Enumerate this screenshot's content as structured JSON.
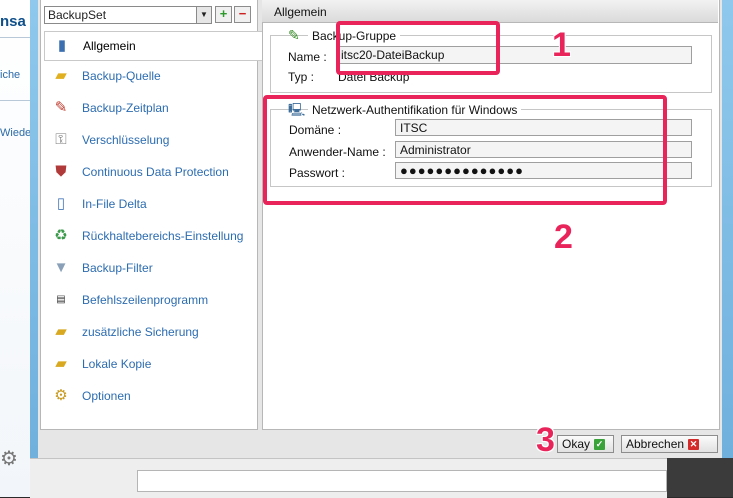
{
  "background_app": {
    "fragments": [
      "nsa",
      "iche",
      "Wiede"
    ]
  },
  "backup_set_selector": {
    "value": "BackupSet",
    "add_label": "+",
    "remove_label": "−"
  },
  "nav": {
    "items": [
      {
        "label": "Allgemein",
        "icon": "general-icon",
        "active": true
      },
      {
        "label": "Backup-Quelle",
        "icon": "folder-icon"
      },
      {
        "label": "Backup-Zeitplan",
        "icon": "schedule-icon"
      },
      {
        "label": "Verschlüsselung",
        "icon": "key-icon"
      },
      {
        "label": "Continuous Data Protection",
        "icon": "shield-icon"
      },
      {
        "label": "In-File Delta",
        "icon": "document-icon"
      },
      {
        "label": "Rückhaltebereichs-Einstellung",
        "icon": "recycle-bin-icon"
      },
      {
        "label": "Backup-Filter",
        "icon": "funnel-icon"
      },
      {
        "label": "Befehlszeilenprogramm",
        "icon": "command-line-icon"
      },
      {
        "label": "zusätzliche Sicherung",
        "icon": "extra-backup-icon"
      },
      {
        "label": "Lokale Kopie",
        "icon": "local-copy-icon"
      },
      {
        "label": "Optionen",
        "icon": "options-icon"
      }
    ]
  },
  "content": {
    "title": "Allgemein",
    "backup_group": {
      "legend": "Backup-Gruppe",
      "name_label": "Name :",
      "name_value": "itsc20-DateiBackup",
      "type_label": "Typ :",
      "type_value": "Datei Backup"
    },
    "network_auth": {
      "legend": "Netzwerk-Authentifikation für Windows",
      "domain_label": "Domäne :",
      "domain_value": "ITSC",
      "user_label": "Anwender-Name :",
      "user_value": "Administrator",
      "password_label": "Passwort :",
      "password_value": "●●●●●●●●●●●●●●"
    }
  },
  "annotations": {
    "marker_1": "1",
    "marker_2": "2",
    "marker_3": "3",
    "color": "#e8245a"
  },
  "footer": {
    "ok_label": "Okay",
    "cancel_label": "Abbrechen"
  }
}
